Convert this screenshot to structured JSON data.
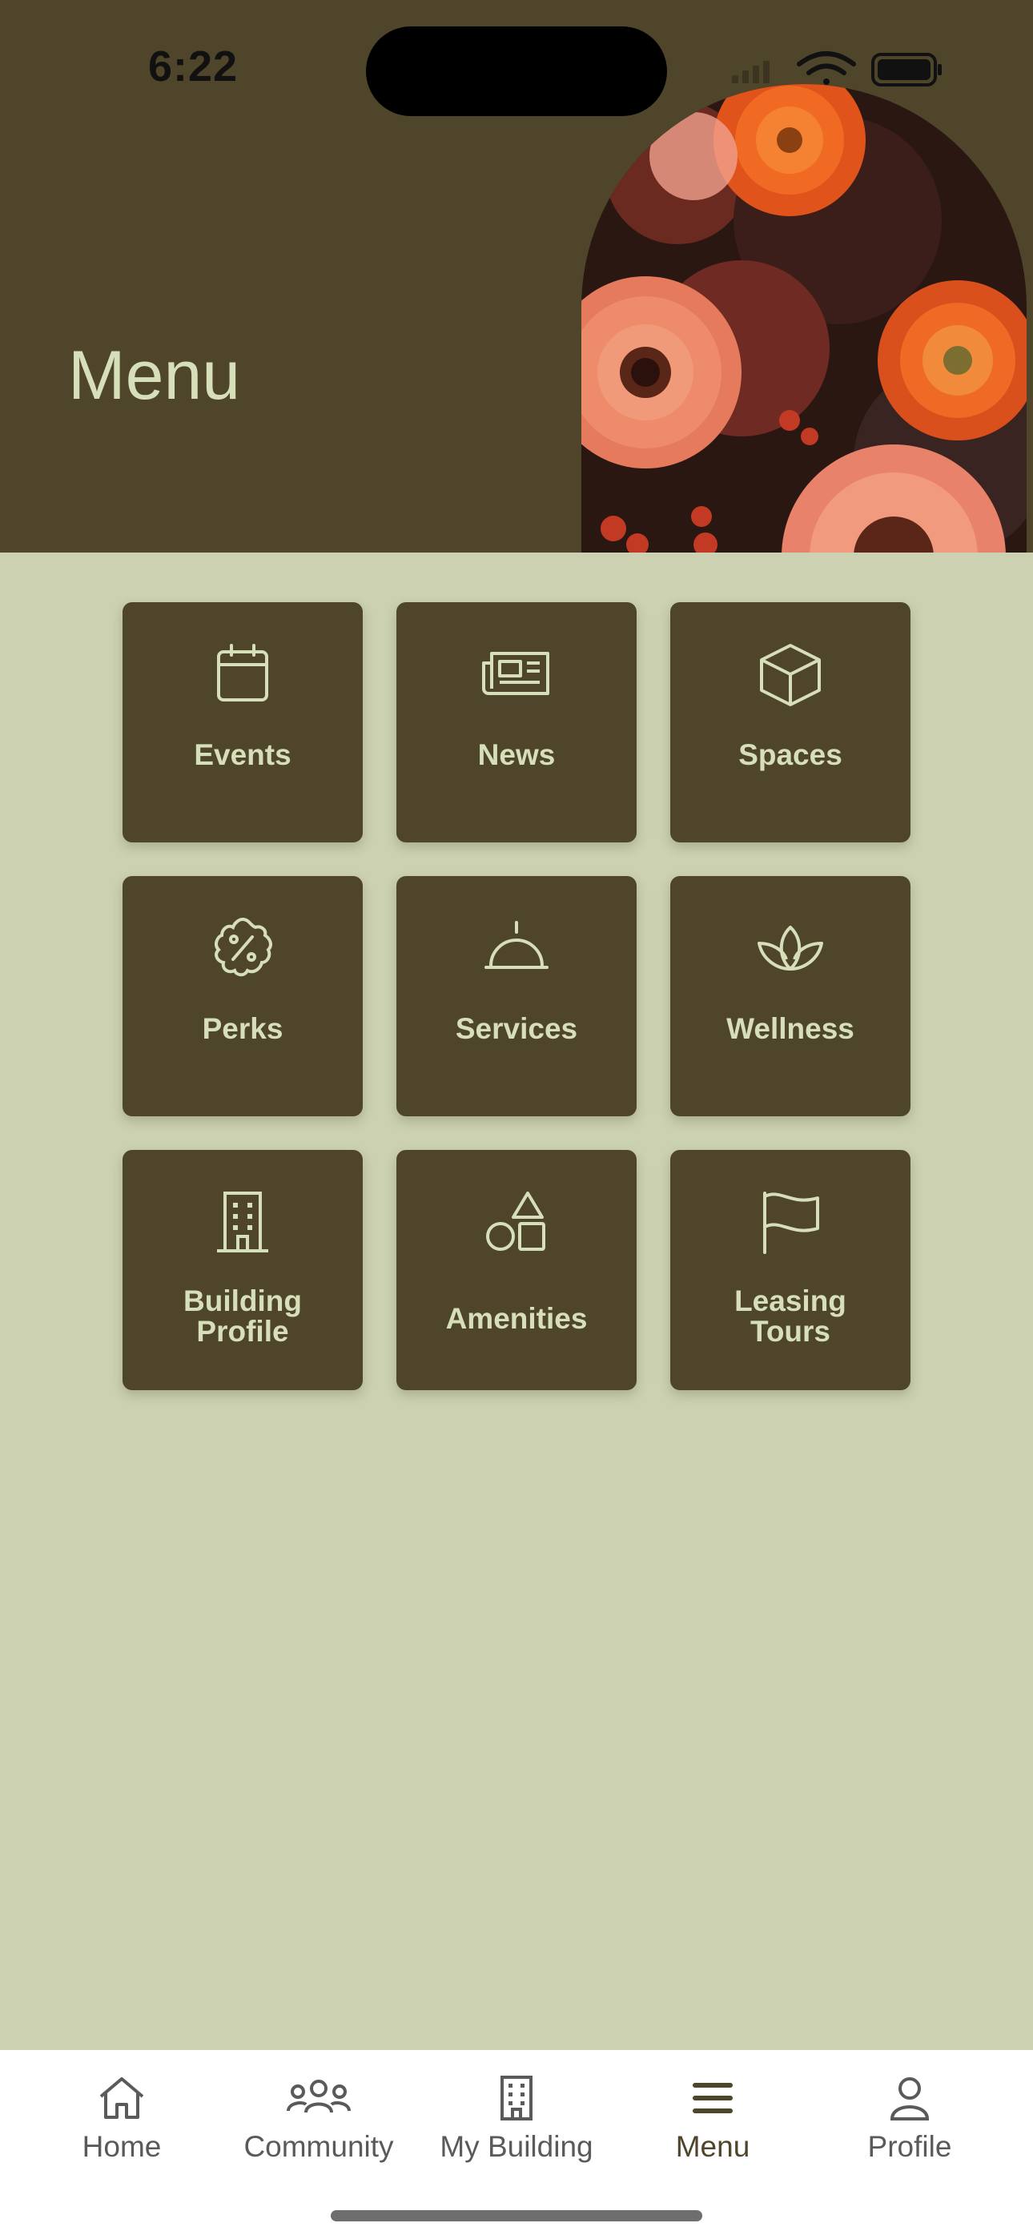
{
  "status_bar": {
    "time": "6:22"
  },
  "header": {
    "title": "Menu"
  },
  "tiles": [
    {
      "label": "Events",
      "icon": "calendar-icon"
    },
    {
      "label": "News",
      "icon": "newspaper-icon"
    },
    {
      "label": "Spaces",
      "icon": "cube-icon"
    },
    {
      "label": "Perks",
      "icon": "percent-badge-icon"
    },
    {
      "label": "Services",
      "icon": "service-bell-icon"
    },
    {
      "label": "Wellness",
      "icon": "lotus-icon"
    },
    {
      "label": "Building Profile",
      "line1": "Building",
      "line2": "Profile",
      "icon": "building-icon"
    },
    {
      "label": "Amenities",
      "icon": "shapes-icon"
    },
    {
      "label": "Leasing Tours",
      "line1": "Leasing",
      "line2": "Tours",
      "icon": "flag-icon"
    }
  ],
  "tabbar": {
    "items": [
      {
        "label": "Home",
        "icon": "home-icon"
      },
      {
        "label": "Community",
        "icon": "people-icon"
      },
      {
        "label": "My Building",
        "icon": "building-icon"
      },
      {
        "label": "Menu",
        "icon": "menu-icon",
        "active": true
      },
      {
        "label": "Profile",
        "icon": "user-icon"
      }
    ]
  },
  "colors": {
    "header_bg": "#4f452a",
    "page_bg": "#cbd1b1",
    "tile_bg": "#4f452a",
    "tile_text": "#d6dfb9",
    "tab_active": "#4f452a",
    "tab_inactive": "#5a5a5a"
  }
}
